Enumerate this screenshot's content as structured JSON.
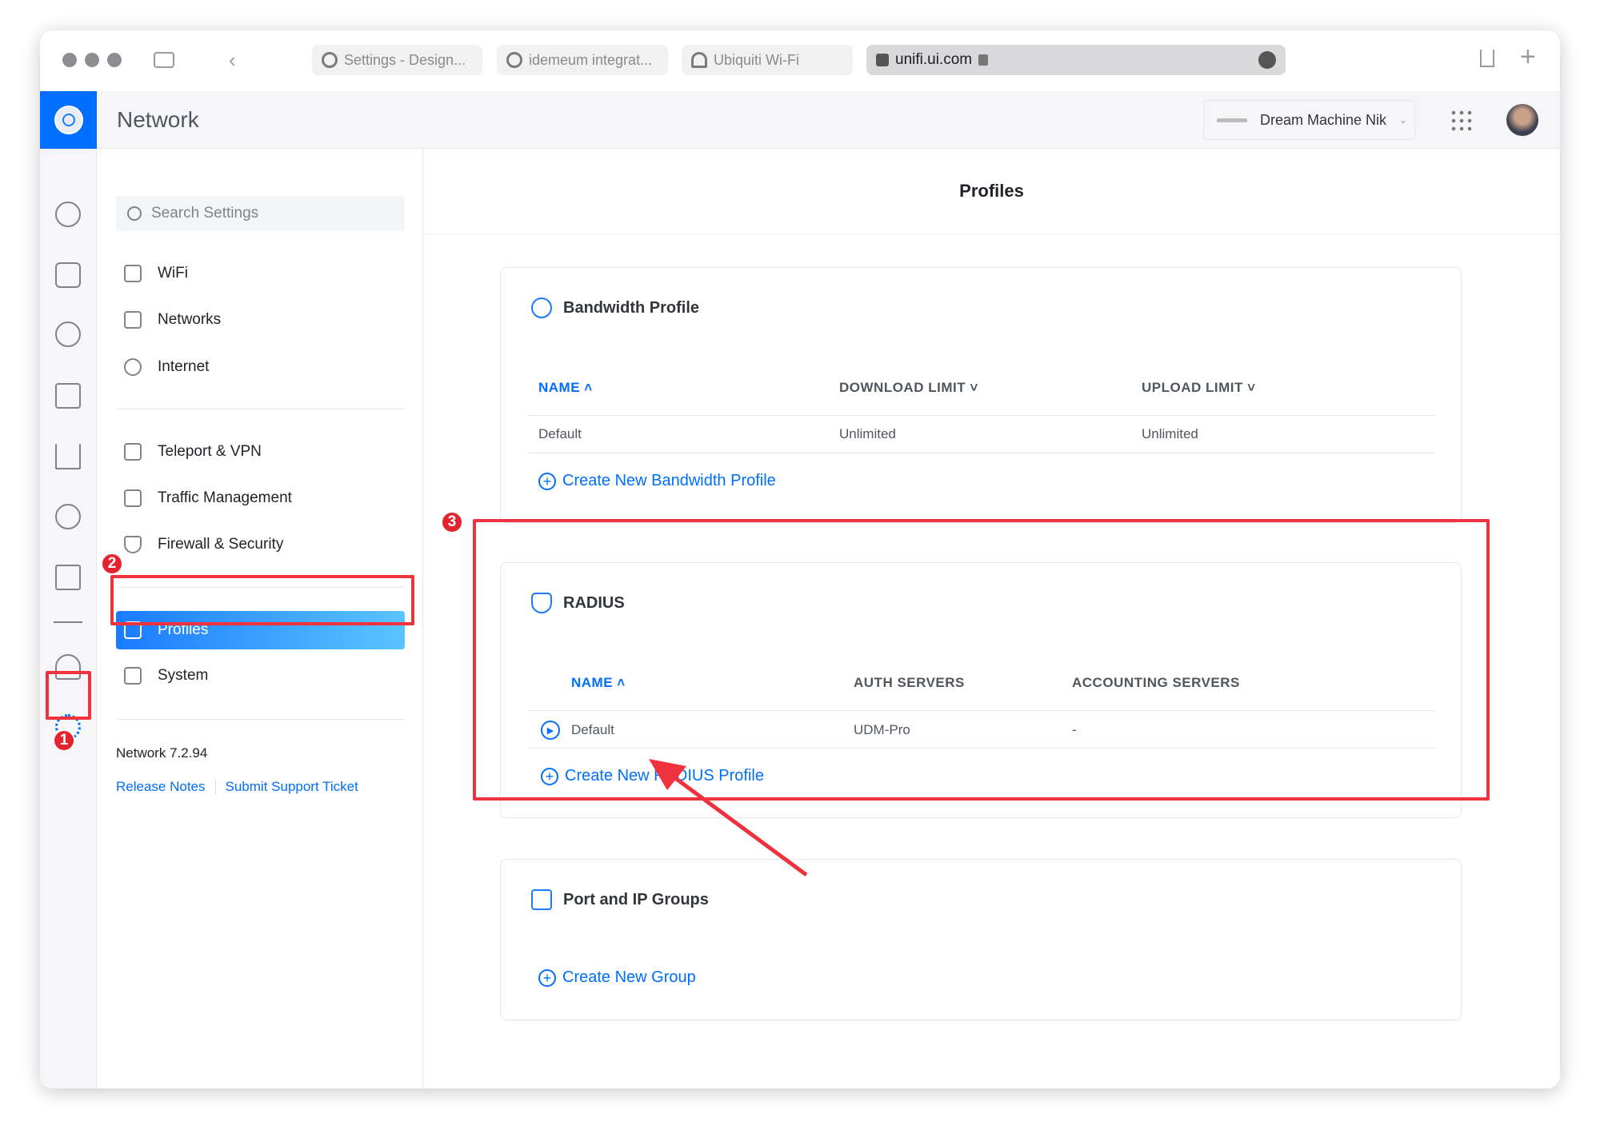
{
  "browser": {
    "tabs": [
      {
        "label": "Settings - Design..."
      },
      {
        "label": "idemeum integrat..."
      },
      {
        "label": "Ubiquiti Wi-Fi"
      }
    ],
    "address": "unifi.ui.com"
  },
  "app": {
    "title": "Network",
    "device": "Dream Machine Nik"
  },
  "sidebar": {
    "search_placeholder": "Search Settings",
    "items": [
      {
        "label": "WiFi",
        "icon": "wifi-icon"
      },
      {
        "label": "Networks",
        "icon": "networks-icon"
      },
      {
        "label": "Internet",
        "icon": "globe-icon"
      },
      {
        "label": "Teleport & VPN",
        "icon": "vpn-icon"
      },
      {
        "label": "Traffic Management",
        "icon": "traffic-icon"
      },
      {
        "label": "Firewall & Security",
        "icon": "shield-icon"
      },
      {
        "label": "Profiles",
        "icon": "profiles-icon",
        "active": true
      },
      {
        "label": "System",
        "icon": "system-icon"
      }
    ],
    "version": "Network 7.2.94",
    "release_notes": "Release Notes",
    "support": "Submit Support Ticket"
  },
  "main": {
    "title": "Profiles",
    "bandwidth": {
      "title": "Bandwidth Profile",
      "columns": [
        "NAME",
        "DOWNLOAD LIMIT",
        "UPLOAD LIMIT"
      ],
      "rows": [
        [
          "Default",
          "Unlimited",
          "Unlimited"
        ]
      ],
      "create": "Create New Bandwidth Profile"
    },
    "radius": {
      "title": "RADIUS",
      "columns": [
        "NAME",
        "AUTH SERVERS",
        "ACCOUNTING SERVERS"
      ],
      "rows": [
        [
          "Default",
          "UDM-Pro",
          "-"
        ]
      ],
      "create": "Create New RADIUS Profile"
    },
    "groups": {
      "title": "Port and IP Groups",
      "create": "Create New Group"
    }
  },
  "annotations": [
    "1",
    "2",
    "3"
  ],
  "colors": {
    "accent": "#006fff",
    "annotation": "#f0323f"
  }
}
